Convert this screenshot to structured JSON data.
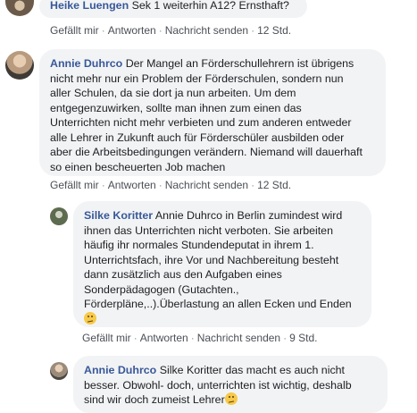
{
  "comments": [
    {
      "author": "Heike Luengen",
      "text": "Sek 1 weiterhin A12? Ernsthaft?",
      "actions": {
        "like": "Gefällt mir",
        "reply": "Antworten",
        "message": "Nachricht senden",
        "time": "12 Std."
      }
    },
    {
      "author": "Annie Duhrco",
      "lines": [
        "Der Mangel an Förderschullehrern ist übrigens",
        "nicht mehr nur ein Problem der Förderschulen, sondern nun",
        "aller Schulen, da sie dort ja nun arbeiten. Um dem",
        "entgegenzuwirken, sollte man ihnen zum einen das",
        "Unterrichten nicht mehr verbieten und zum anderen entweder",
        "alle Lehrer in Zukunft auch für Förderschüler ausbilden oder",
        "aber die Arbeitsbedingungen verändern. Niemand will dauerhaft",
        "so einen bescheuerten Job machen"
      ],
      "actions": {
        "like": "Gefällt mir",
        "reply": "Antworten",
        "message": "Nachricht senden",
        "time": "12 Std."
      }
    },
    {
      "author": "Silke Koritter",
      "lines": [
        "Annie Duhrco in Berlin zumindest wird",
        "ihnen das Unterrichten nicht verboten. Sie arbeiten",
        "häufig ihr normales Stundendeputat in ihrem 1.",
        "Unterrichtsfach, ihre Vor und Nachbereitung besteht",
        "dann zusätzlich aus den Aufgaben eines",
        "Sonderpädagogen (Gutachten.,",
        "Förderpläne,..).Überlastung an allen Ecken und Enden"
      ],
      "emoji": "confused-face",
      "actions": {
        "like": "Gefällt mir",
        "reply": "Antworten",
        "message": "Nachricht senden",
        "time": "9 Std."
      }
    },
    {
      "author": "Annie Duhrco",
      "lines": [
        "Silke Koritter das macht es auch nicht",
        "besser. Obwohl- doch, unterrichten ist wichtig, deshalb",
        "sind wir doch zumeist Lehrer"
      ],
      "emoji": "confused-face"
    }
  ]
}
